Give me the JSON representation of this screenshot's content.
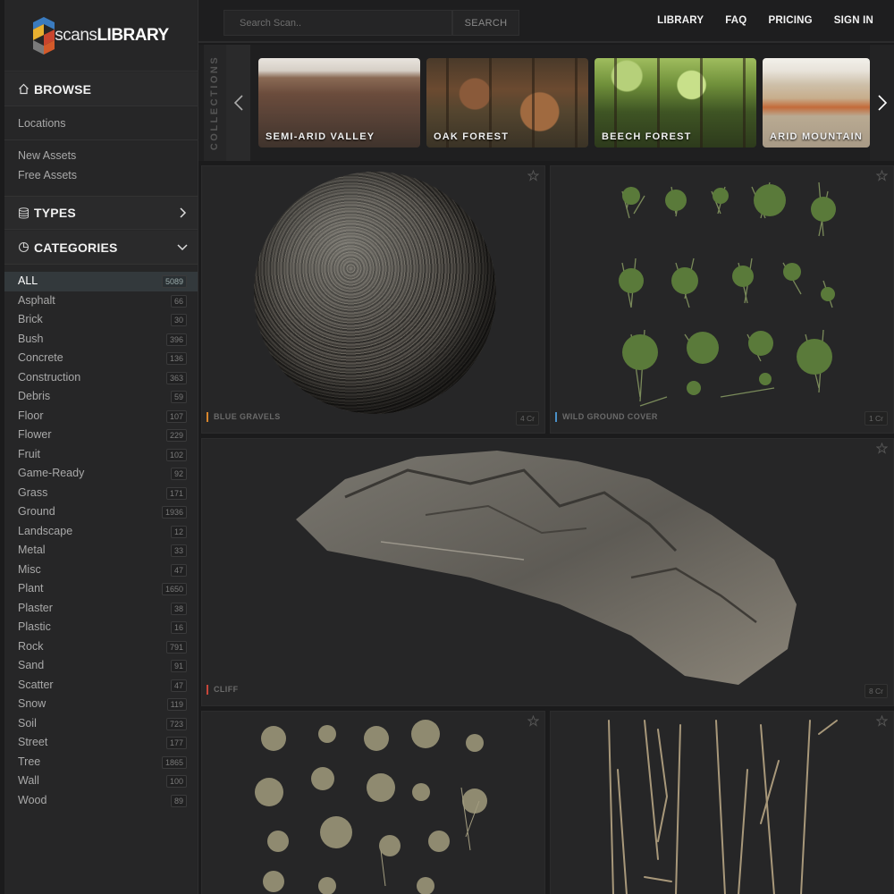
{
  "logo": {
    "text_thin": "scans",
    "text_bold": "LIBRARY"
  },
  "search": {
    "placeholder": "Search Scan..",
    "button": "SEARCH"
  },
  "nav": [
    "LIBRARY",
    "FAQ",
    "PRICING",
    "SIGN IN"
  ],
  "sidebar": {
    "browse": "BROWSE",
    "links": [
      "Locations",
      "New Assets",
      "Free Assets"
    ],
    "types": "TYPES",
    "categories": "CATEGORIES",
    "category_items": [
      {
        "label": "ALL",
        "count": "5089"
      },
      {
        "label": "Asphalt",
        "count": "66"
      },
      {
        "label": "Brick",
        "count": "30"
      },
      {
        "label": "Bush",
        "count": "396"
      },
      {
        "label": "Concrete",
        "count": "136"
      },
      {
        "label": "Construction",
        "count": "363"
      },
      {
        "label": "Debris",
        "count": "59"
      },
      {
        "label": "Floor",
        "count": "107"
      },
      {
        "label": "Flower",
        "count": "229"
      },
      {
        "label": "Fruit",
        "count": "102"
      },
      {
        "label": "Game-Ready",
        "count": "92"
      },
      {
        "label": "Grass",
        "count": "171"
      },
      {
        "label": "Ground",
        "count": "1936"
      },
      {
        "label": "Landscape",
        "count": "12"
      },
      {
        "label": "Metal",
        "count": "33"
      },
      {
        "label": "Misc",
        "count": "47"
      },
      {
        "label": "Plant",
        "count": "1650"
      },
      {
        "label": "Plaster",
        "count": "38"
      },
      {
        "label": "Plastic",
        "count": "16"
      },
      {
        "label": "Rock",
        "count": "791"
      },
      {
        "label": "Sand",
        "count": "91"
      },
      {
        "label": "Scatter",
        "count": "47"
      },
      {
        "label": "Snow",
        "count": "119"
      },
      {
        "label": "Soil",
        "count": "723"
      },
      {
        "label": "Street",
        "count": "177"
      },
      {
        "label": "Tree",
        "count": "1865"
      },
      {
        "label": "Wall",
        "count": "100"
      },
      {
        "label": "Wood",
        "count": "89"
      }
    ]
  },
  "collections": {
    "label": "COLLECTIONS",
    "items": [
      "SEMI-ARID VALLEY",
      "OAK FOREST",
      "BEECH FOREST",
      "ARID MOUNTAIN"
    ]
  },
  "assets": [
    {
      "name": "BLUE GRAVELS",
      "credits": "4 Cr",
      "accent": "#d8862c"
    },
    {
      "name": "WILD GROUND COVER",
      "credits": "1 Cr",
      "accent": "#4a90c8"
    },
    {
      "name": "CLIFF",
      "credits": "8 Cr",
      "accent": "#c8463a"
    }
  ],
  "colors": {
    "background": "#1b1b1c",
    "sidebar": "#262627",
    "active_category": "#33393c"
  }
}
